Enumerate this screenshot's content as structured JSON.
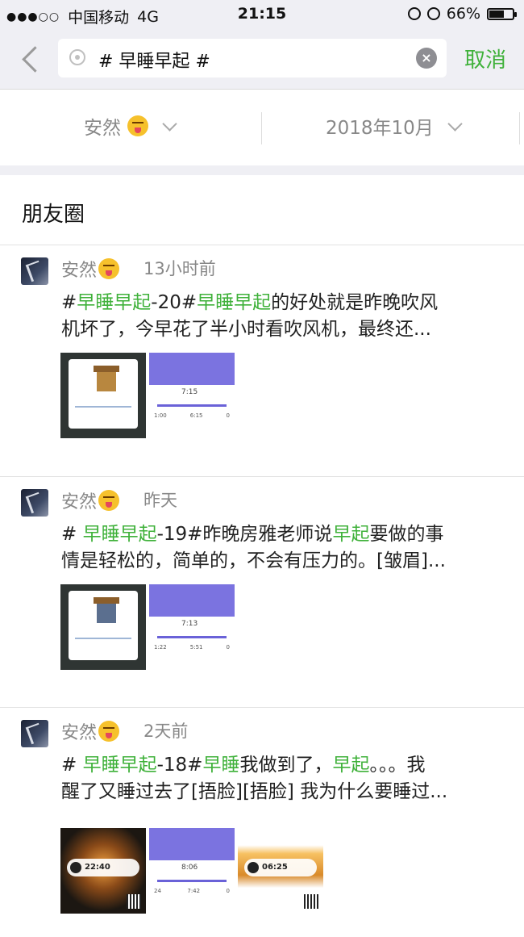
{
  "status_bar": {
    "signal_dots": "●●●○○",
    "carrier": "中国移动",
    "network": "4G",
    "time": "21:15",
    "battery_text": "66%",
    "battery_level": 0.66
  },
  "search": {
    "query": "# 早睡早起 #",
    "cancel_label": "取消"
  },
  "filters": {
    "user": "安然",
    "date": "2018年10月"
  },
  "section_title": "朋友圈",
  "posts": [
    {
      "name": "安然",
      "time": "13小时前",
      "line1": [
        {
          "t": "#",
          "hl": false
        },
        {
          "t": "早睡早起",
          "hl": true
        },
        {
          "t": "-20#",
          "hl": false
        },
        {
          "t": "早睡早起",
          "hl": true
        },
        {
          "t": "的好处就是昨晚吹风",
          "hl": false
        }
      ],
      "line2": "机坏了，今早花了半小时看吹风机，最终还...",
      "thumb_purple_numbers": [
        "7:15",
        "1:00",
        "6:15",
        "0"
      ]
    },
    {
      "name": "安然",
      "time": "昨天",
      "line1": [
        {
          "t": "# ",
          "hl": false
        },
        {
          "t": "早睡早起",
          "hl": true
        },
        {
          "t": "-19#昨晚房雅老师说",
          "hl": false
        },
        {
          "t": "早起",
          "hl": true
        },
        {
          "t": "要做的事",
          "hl": false
        }
      ],
      "line2": "情是轻松的，简单的，不会有压力的。[皱眉]...",
      "thumb_purple_numbers": [
        "7:13",
        "1:22",
        "5:51",
        "0"
      ]
    },
    {
      "name": "安然",
      "time": "2天前",
      "line1": [
        {
          "t": "# ",
          "hl": false
        },
        {
          "t": "早睡早起",
          "hl": true
        },
        {
          "t": "-18#",
          "hl": false
        },
        {
          "t": "早睡",
          "hl": true
        },
        {
          "t": "我做到了，",
          "hl": false
        },
        {
          "t": "早起",
          "hl": true
        },
        {
          "t": "。。。我",
          "hl": false
        }
      ],
      "line2": "醒了又睡过去了[捂脸][捂脸] 我为什么要睡过...",
      "thumb_purple_numbers": [
        "8:06",
        "24",
        "7:42",
        "0"
      ],
      "thumb_photo1_time": "22:40",
      "thumb_photo2_time": "06:25"
    }
  ],
  "colors": {
    "accent_green": "#3fb13a",
    "header_bg": "#efeff4",
    "muted_text": "#888888"
  }
}
